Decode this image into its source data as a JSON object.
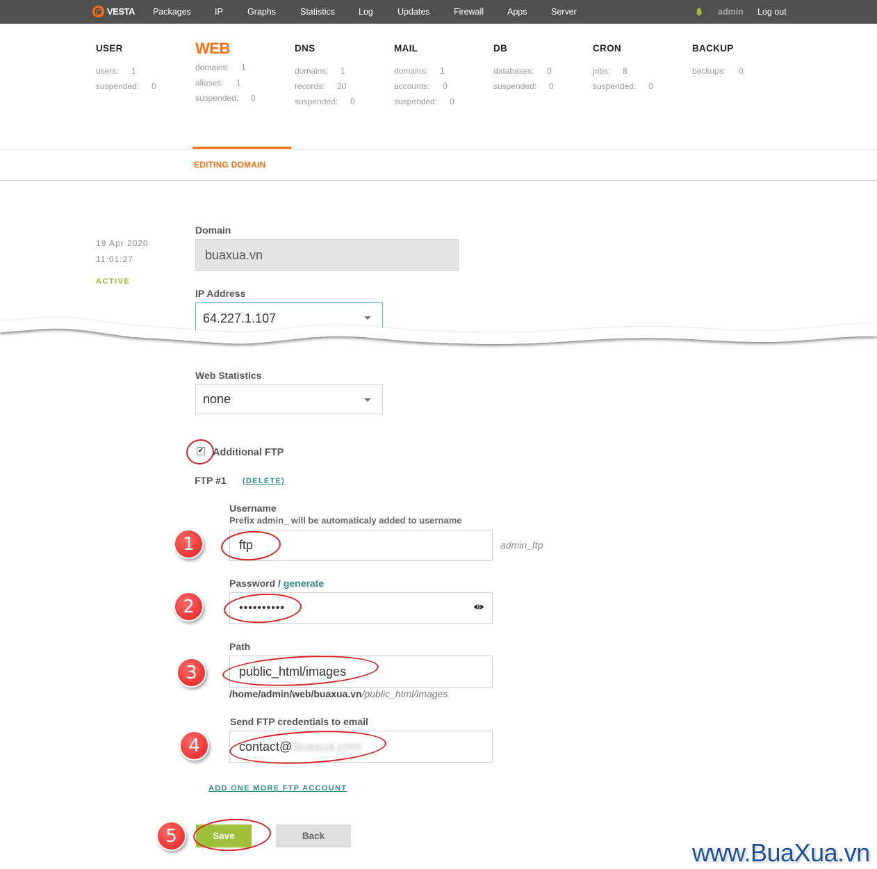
{
  "topbar": {
    "logo": "VESTA",
    "nav": [
      "Packages",
      "IP",
      "Graphs",
      "Statistics",
      "Log",
      "Updates",
      "Firewall",
      "Apps",
      "Server"
    ],
    "user": "admin",
    "logout": "Log out"
  },
  "stats": [
    {
      "title": "USER",
      "active": false,
      "rows": [
        {
          "label": "users:",
          "value": "1"
        },
        {
          "label": "suspended:",
          "value": "0"
        }
      ]
    },
    {
      "title": "WEB",
      "active": true,
      "rows": [
        {
          "label": "domains:",
          "value": "1"
        },
        {
          "label": "aliases:",
          "value": "1"
        },
        {
          "label": "suspended:",
          "value": "0"
        }
      ]
    },
    {
      "title": "DNS",
      "active": false,
      "rows": [
        {
          "label": "domains:",
          "value": "1"
        },
        {
          "label": "records:",
          "value": "20"
        },
        {
          "label": "suspended:",
          "value": "0"
        }
      ]
    },
    {
      "title": "MAIL",
      "active": false,
      "rows": [
        {
          "label": "domains:",
          "value": "1"
        },
        {
          "label": "accounts:",
          "value": "0"
        },
        {
          "label": "suspended:",
          "value": "0"
        }
      ]
    },
    {
      "title": "DB",
      "active": false,
      "rows": [
        {
          "label": "databases:",
          "value": "0"
        },
        {
          "label": "suspended:",
          "value": "0"
        }
      ]
    },
    {
      "title": "CRON",
      "active": false,
      "rows": [
        {
          "label": "jobs:",
          "value": "8"
        },
        {
          "label": "suspended:",
          "value": "0"
        }
      ]
    },
    {
      "title": "BACKUP",
      "active": false,
      "rows": [
        {
          "label": "backups:",
          "value": "0"
        }
      ]
    }
  ],
  "tab": {
    "label": "EDITING DOMAIN"
  },
  "meta": {
    "date": "19  Apr  2020",
    "time": "11:01:27",
    "status": "ACTIVE"
  },
  "form": {
    "domain_label": "Domain",
    "domain_value": "buaxua.vn",
    "ip_label": "IP Address",
    "ip_value": "64.227.1.107",
    "stats_label": "Web Statistics",
    "stats_value": "none",
    "additional_ftp_label": "Additional FTP",
    "additional_ftp_checked": true,
    "ftp_title": "FTP #1",
    "ftp_delete": "(DELETE)",
    "username_label": "Username",
    "username_hint": "Prefix admin_ will be automaticaly added to username",
    "username_value": "ftp",
    "username_suffix": "admin_ftp",
    "password_label": "Password /",
    "password_generate": "generate",
    "password_value": "••••••••••",
    "path_label": "Path",
    "path_value": "public_html/images",
    "path_prefix": "/home/admin/web/buaxua.vn",
    "path_suffix": "/public_html/images",
    "email_label": "Send FTP credentials to email",
    "email_value": "contact@",
    "email_blurred": "buaxua.com",
    "add_more": "ADD ONE MORE FTP ACCOUNT",
    "save_label": "Save",
    "back_label": "Back"
  },
  "annotations": [
    "1",
    "2",
    "3",
    "4",
    "5"
  ],
  "watermark": "www.BuaXua.vn",
  "colors": {
    "accent": "#ff6e10",
    "save": "#9fc03a",
    "link": "#2d8a8a",
    "active_status": "#8dbd2f",
    "annotation": "#e02020"
  }
}
